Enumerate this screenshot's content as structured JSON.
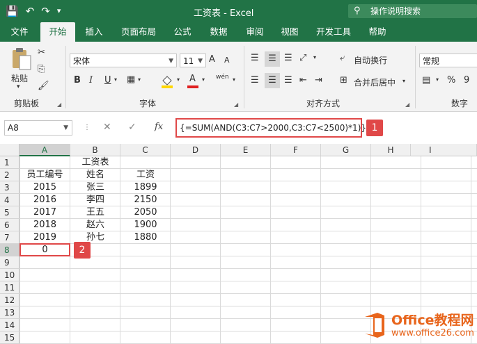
{
  "window": {
    "title": "工资表 - Excel",
    "search_label": "操作说明搜索"
  },
  "qat": {
    "save_icon": "💾",
    "undo_icon": "↶",
    "redo_icon": "↷",
    "customize_icon": "▾"
  },
  "tabs": [
    {
      "label": "文件"
    },
    {
      "label": "开始"
    },
    {
      "label": "插入"
    },
    {
      "label": "页面布局"
    },
    {
      "label": "公式"
    },
    {
      "label": "数据"
    },
    {
      "label": "审阅"
    },
    {
      "label": "视图"
    },
    {
      "label": "开发工具"
    },
    {
      "label": "帮助"
    }
  ],
  "ribbon": {
    "clipboard": {
      "paste_label": "粘贴",
      "group_label": "剪贴板"
    },
    "font": {
      "font_name": "宋体",
      "font_size": "11",
      "bold": "B",
      "italic": "I",
      "underline": "U",
      "grow": "A",
      "shrink": "A",
      "font_color": "A",
      "wen": "wén",
      "group_label": "字体"
    },
    "alignment": {
      "wrap_label": "自动换行",
      "merge_label": "合并后居中",
      "group_label": "对齐方式"
    },
    "number": {
      "format": "常规",
      "percent": "%",
      "comma": "9",
      "group_label": "数字"
    }
  },
  "formula_bar": {
    "name_box": "A8",
    "cancel": "✕",
    "enter": "✓",
    "fx": "fx",
    "formula": "{=SUM(AND(C3:C7>2000,C3:C7<2500)*1)}",
    "badge1": "1",
    "badge2": "2"
  },
  "columns": [
    "A",
    "B",
    "C",
    "D",
    "E",
    "F",
    "G",
    "H",
    "I"
  ],
  "rows": [
    "1",
    "2",
    "3",
    "4",
    "5",
    "6",
    "7",
    "8",
    "9",
    "10",
    "11",
    "12",
    "13",
    "14",
    "15"
  ],
  "cells": {
    "B1": "工资表",
    "A2": "员工编号",
    "B2": "姓名",
    "C2": "工资",
    "A3": "2015",
    "B3": "张三",
    "C3": "1899",
    "A4": "2016",
    "B4": "李四",
    "C4": "2150",
    "A5": "2017",
    "B5": "王五",
    "C5": "2050",
    "A6": "2018",
    "B6": "赵六",
    "C6": "1900",
    "A7": "2019",
    "B7": "孙七",
    "C7": "1880",
    "A8": "0"
  },
  "watermark": {
    "line1": "Office教程网",
    "line2": "www.office26.com"
  },
  "colors": {
    "accent": "#217346",
    "highlight": "#e04848",
    "brand": "#e8651c"
  }
}
